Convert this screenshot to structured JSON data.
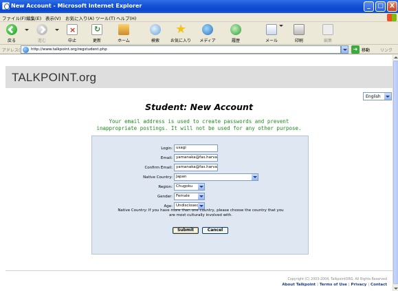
{
  "window": {
    "title": "New Account - Microsoft Internet Explorer",
    "buttons": {
      "minimize": "_",
      "maximize": "□",
      "close": "X"
    }
  },
  "menu": [
    "ファイル(F)",
    "編集(E)",
    "表示(V)",
    "お気に入り(A)",
    "ツール(T)",
    "ヘルプ(H)"
  ],
  "toolbar": {
    "back": "戻る",
    "forward": "進む",
    "stop": "中止",
    "refresh": "更新",
    "home": "ホーム",
    "search": "検索",
    "favorites": "お気に入り",
    "media": "メディア",
    "history": "履歴",
    "mail": "メール",
    "print": "印刷",
    "edit": "編集"
  },
  "address": {
    "label": "アドレス(D)",
    "url": "http://www.talkpoint.org/regstudent.php",
    "go": "移動",
    "links": "リンク"
  },
  "page": {
    "site_name": "TALKPOINT.org",
    "language": "English",
    "title": "Student: New Account",
    "notice_line1": "Your email address is used to create passwords and prevent",
    "notice_line2": "inappropriate postings. It will not be used for any other purpose.",
    "form": {
      "login_label": "Login:",
      "login_value": "usagi",
      "email_label": "Email:",
      "email_value": "yamanaka@fas.harva",
      "confirm_label": "Confirm Email:",
      "confirm_value": "yamanaka@fas.harva",
      "country_label": "Native Country:",
      "country_value": "Japan",
      "region_label": "Region:",
      "region_value": "Chugoku",
      "gender_label": "Gender:",
      "gender_value": "Female",
      "age_label": "Age:",
      "age_value": "Undisclosed",
      "help_line1": "Native Country: If you have more than one country, please choose the country that you",
      "help_line2": "are most culturally involved with.",
      "submit": "Submit",
      "cancel": "Cancel"
    },
    "footer": {
      "copyright": "Copyright (C) 2003-2004, TalkpointORG. All Rights Reserved",
      "about": "About Talkpoint",
      "terms": "Terms of Use",
      "privacy": "Privacy",
      "contact": "Contact",
      "separator": "|"
    }
  },
  "colors": {
    "titlebar": "#0b46cd",
    "chrome": "#ece9d8",
    "notice_green": "#1f8a1f",
    "form_bg": "#dfe7f3",
    "header_bg": "#dedede",
    "footer_link": "#1b3c87"
  }
}
